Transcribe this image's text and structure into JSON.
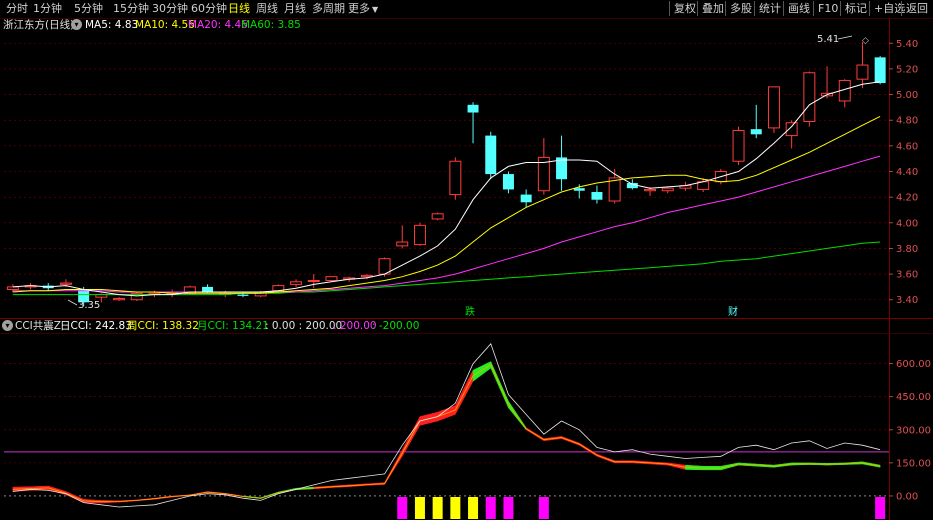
{
  "toolbar": {
    "left_items": [
      "分时",
      "1分钟",
      "5分钟",
      "15分钟",
      "30分钟",
      "60分钟",
      "日线",
      "周线",
      "月线",
      "多周期",
      "更多"
    ],
    "active": "日线",
    "right_items": [
      "复权",
      "叠加",
      "多股",
      "统计",
      "画线",
      "F10",
      "标记",
      "+自选",
      "返回"
    ]
  },
  "stock": {
    "name": "浙江东方(日线)",
    "ma5": "MA5: 4.83",
    "ma10": "MA10: 4.56",
    "ma20": "MA20: 4.46",
    "ma60": "MA60: 3.85",
    "high_label": "5.41",
    "low_label": "3.35",
    "marker_1": "跌",
    "marker_2": "财"
  },
  "cci": {
    "title": "CCI共震Z",
    "day": "日CCI: 242.83",
    "week": "周CCI: 138.32",
    "month": "月CCI: 134.21",
    "params": ": 0.00 : 200.00",
    "level_pos": ": 200.00",
    "level_neg": ": -200.00"
  },
  "colors": {
    "up": "#ff3c3c",
    "down": "#54ffff",
    "ma5": "#ffffff",
    "ma10": "#ffff00",
    "ma20": "#ff33ff",
    "ma60": "#00dd00",
    "axis": "#e05050",
    "grid": "#7a0000"
  },
  "chart_data": [
    {
      "type": "candlestick",
      "title": "浙江东方(日线)",
      "y_ticks": [
        3.4,
        3.6,
        3.8,
        4.0,
        4.2,
        4.4,
        4.6,
        4.8,
        5.0,
        5.2,
        5.4
      ],
      "ylim": [
        3.32,
        5.48
      ],
      "candles": [
        [
          3.48,
          3.52,
          3.46,
          3.5
        ],
        [
          3.5,
          3.53,
          3.48,
          3.51
        ],
        [
          3.51,
          3.53,
          3.47,
          3.49
        ],
        [
          3.52,
          3.56,
          3.5,
          3.53
        ],
        [
          3.48,
          3.5,
          3.35,
          3.38
        ],
        [
          3.42,
          3.45,
          3.38,
          3.44
        ],
        [
          3.4,
          3.42,
          3.39,
          3.41
        ],
        [
          3.4,
          3.46,
          3.39,
          3.45
        ],
        [
          3.44,
          3.47,
          3.42,
          3.45
        ],
        [
          3.45,
          3.48,
          3.42,
          3.46
        ],
        [
          3.45,
          3.51,
          3.44,
          3.5
        ],
        [
          3.5,
          3.52,
          3.45,
          3.46
        ],
        [
          3.44,
          3.47,
          3.42,
          3.45
        ],
        [
          3.44,
          3.46,
          3.42,
          3.43
        ],
        [
          3.43,
          3.47,
          3.42,
          3.46
        ],
        [
          3.47,
          3.52,
          3.45,
          3.51
        ],
        [
          3.52,
          3.56,
          3.5,
          3.54
        ],
        [
          3.55,
          3.6,
          3.49,
          3.55
        ],
        [
          3.55,
          3.57,
          3.54,
          3.58
        ],
        [
          3.56,
          3.58,
          3.54,
          3.57
        ],
        [
          3.58,
          3.6,
          3.56,
          3.59
        ],
        [
          3.6,
          3.73,
          3.58,
          3.72
        ],
        [
          3.82,
          3.98,
          3.8,
          3.85
        ],
        [
          3.83,
          4.0,
          3.82,
          3.98
        ],
        [
          4.03,
          4.08,
          4.02,
          4.07
        ],
        [
          4.22,
          4.51,
          4.18,
          4.48
        ],
        [
          4.92,
          4.94,
          4.62,
          4.86
        ],
        [
          4.68,
          4.71,
          4.34,
          4.38
        ],
        [
          4.38,
          4.4,
          4.23,
          4.26
        ],
        [
          4.22,
          4.26,
          4.12,
          4.16
        ],
        [
          4.25,
          4.66,
          4.22,
          4.51
        ],
        [
          4.51,
          4.68,
          4.25,
          4.34
        ],
        [
          4.27,
          4.3,
          4.19,
          4.25
        ],
        [
          4.24,
          4.29,
          4.15,
          4.18
        ],
        [
          4.17,
          4.42,
          4.15,
          4.35
        ],
        [
          4.31,
          4.34,
          4.26,
          4.27
        ],
        [
          4.25,
          4.28,
          4.21,
          4.26
        ],
        [
          4.25,
          4.28,
          4.23,
          4.27
        ],
        [
          4.27,
          4.32,
          4.25,
          4.29
        ],
        [
          4.26,
          4.35,
          4.24,
          4.32
        ],
        [
          4.32,
          4.42,
          4.3,
          4.4
        ],
        [
          4.48,
          4.75,
          4.45,
          4.72
        ],
        [
          4.73,
          4.92,
          4.66,
          4.69
        ],
        [
          4.74,
          5.06,
          4.7,
          5.06
        ],
        [
          4.68,
          4.8,
          4.58,
          4.78
        ],
        [
          4.79,
          5.18,
          4.75,
          5.17
        ],
        [
          4.99,
          5.22,
          4.97,
          5.01
        ],
        [
          4.95,
          5.12,
          4.9,
          5.11
        ],
        [
          5.12,
          5.41,
          5.05,
          5.23
        ],
        [
          5.29,
          5.3,
          5.08,
          5.09
        ]
      ],
      "ma5": [
        3.5,
        3.51,
        3.5,
        3.51,
        3.48,
        3.46,
        3.44,
        3.43,
        3.44,
        3.44,
        3.46,
        3.46,
        3.46,
        3.46,
        3.46,
        3.47,
        3.49,
        3.52,
        3.54,
        3.56,
        3.57,
        3.6,
        3.67,
        3.74,
        3.82,
        3.95,
        4.18,
        4.35,
        4.44,
        4.47,
        4.47,
        4.49,
        4.49,
        4.48,
        4.38,
        4.3,
        4.27,
        4.28,
        4.29,
        4.32,
        4.36,
        4.4,
        4.5,
        4.62,
        4.75,
        4.92,
        5.0,
        5.04,
        5.08,
        5.1
      ],
      "ma10": [
        3.46,
        3.47,
        3.47,
        3.48,
        3.48,
        3.48,
        3.47,
        3.46,
        3.46,
        3.45,
        3.45,
        3.45,
        3.45,
        3.45,
        3.45,
        3.46,
        3.47,
        3.48,
        3.49,
        3.51,
        3.53,
        3.55,
        3.58,
        3.62,
        3.67,
        3.74,
        3.85,
        3.96,
        4.04,
        4.12,
        4.18,
        4.24,
        4.28,
        4.31,
        4.33,
        4.35,
        4.36,
        4.37,
        4.37,
        4.34,
        4.32,
        4.33,
        4.37,
        4.43,
        4.49,
        4.55,
        4.62,
        4.69,
        4.76,
        4.83
      ],
      "ma20": [
        3.47,
        3.47,
        3.47,
        3.47,
        3.47,
        3.47,
        3.46,
        3.46,
        3.46,
        3.46,
        3.46,
        3.46,
        3.46,
        3.46,
        3.46,
        3.46,
        3.46,
        3.47,
        3.48,
        3.49,
        3.5,
        3.51,
        3.53,
        3.55,
        3.57,
        3.6,
        3.64,
        3.68,
        3.72,
        3.76,
        3.8,
        3.85,
        3.89,
        3.93,
        3.97,
        4.0,
        4.04,
        4.08,
        4.11,
        4.14,
        4.17,
        4.2,
        4.24,
        4.28,
        4.32,
        4.36,
        4.4,
        4.44,
        4.48,
        4.52
      ],
      "ma60": [
        3.44,
        3.44,
        3.44,
        3.44,
        3.44,
        3.44,
        3.44,
        3.44,
        3.44,
        3.44,
        3.44,
        3.44,
        3.44,
        3.45,
        3.45,
        3.45,
        3.46,
        3.46,
        3.47,
        3.48,
        3.49,
        3.5,
        3.51,
        3.52,
        3.53,
        3.54,
        3.55,
        3.56,
        3.57,
        3.58,
        3.59,
        3.6,
        3.61,
        3.62,
        3.63,
        3.64,
        3.65,
        3.66,
        3.67,
        3.68,
        3.7,
        3.71,
        3.72,
        3.74,
        3.76,
        3.78,
        3.8,
        3.82,
        3.84,
        3.85
      ]
    },
    {
      "type": "line",
      "title": "CCI共震Z",
      "y_ticks": [
        0.0,
        150.0,
        300.0,
        450.0,
        600.0
      ],
      "ylim": [
        -100,
        730
      ],
      "level": 200,
      "day_cci": [
        20,
        30,
        25,
        10,
        -30,
        -40,
        -50,
        -45,
        -40,
        -20,
        0,
        10,
        5,
        -10,
        -20,
        10,
        30,
        50,
        70,
        80,
        90,
        100,
        230,
        340,
        360,
        420,
        600,
        690,
        460,
        370,
        280,
        340,
        300,
        220,
        200,
        210,
        190,
        180,
        170,
        175,
        180,
        220,
        230,
        210,
        240,
        250,
        215,
        240,
        230,
        210
      ],
      "cci_upper": [
        40,
        42,
        45,
        20,
        -15,
        -20,
        -22,
        -18,
        -10,
        0,
        5,
        20,
        12,
        0,
        -8,
        18,
        35,
        40,
        45,
        50,
        55,
        60,
        210,
        360,
        380,
        410,
        570,
        610,
        430,
        310,
        260,
        270,
        240,
        190,
        160,
        160,
        155,
        150,
        140,
        135,
        135,
        150,
        145,
        140,
        150,
        150,
        148,
        150,
        155,
        140
      ],
      "cci_lower": [
        20,
        25,
        28,
        5,
        -30,
        -32,
        -28,
        -22,
        -15,
        -5,
        2,
        15,
        8,
        -4,
        -12,
        12,
        28,
        32,
        38,
        42,
        48,
        52,
        180,
        320,
        340,
        370,
        520,
        580,
        400,
        300,
        250,
        260,
        230,
        180,
        150,
        150,
        145,
        140,
        120,
        118,
        118,
        140,
        135,
        130,
        140,
        142,
        140,
        142,
        145,
        130
      ],
      "up_segments": [
        [
          0,
          13
        ],
        [
          17,
          26
        ],
        [
          29,
          38
        ]
      ],
      "signals": [
        {
          "index": 22,
          "color": "#ff00ff"
        },
        {
          "index": 23,
          "color": "#ffff00"
        },
        {
          "index": 24,
          "color": "#ffff00"
        },
        {
          "index": 25,
          "color": "#ffff00"
        },
        {
          "index": 26,
          "color": "#ffff00"
        },
        {
          "index": 27,
          "color": "#ff00ff"
        },
        {
          "index": 28,
          "color": "#ff00ff"
        },
        {
          "index": 30,
          "color": "#ff00ff"
        },
        {
          "index": 49,
          "color": "#ff00ff"
        }
      ]
    }
  ]
}
